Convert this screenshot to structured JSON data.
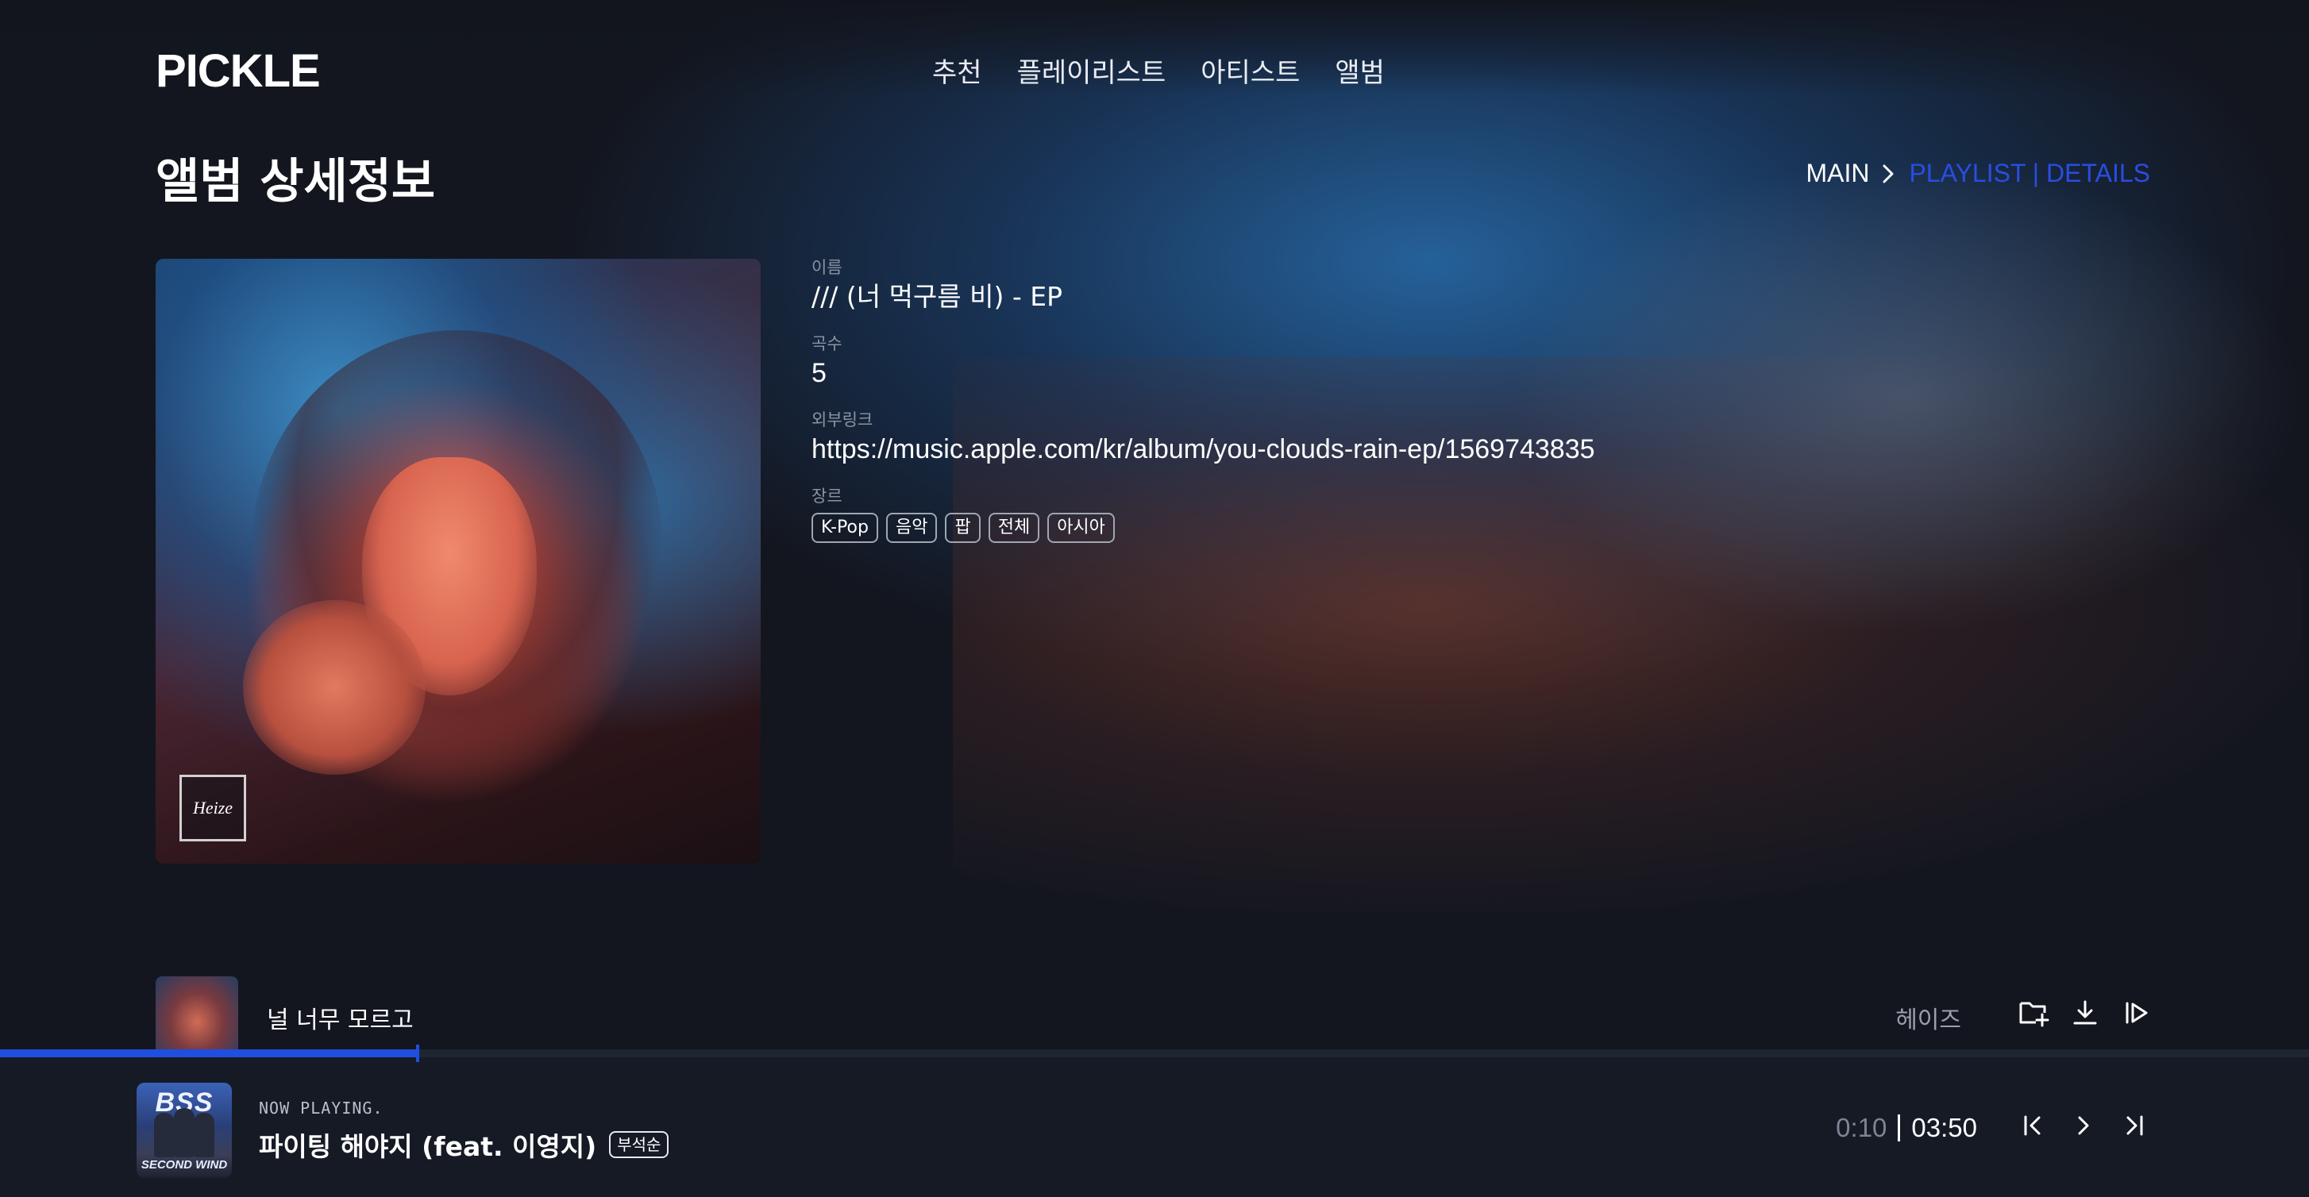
{
  "app": {
    "logo": "PICKLE"
  },
  "nav": {
    "items": [
      {
        "label": "추천"
      },
      {
        "label": "플레이리스트"
      },
      {
        "label": "아티스트"
      },
      {
        "label": "앨범"
      }
    ]
  },
  "page": {
    "title": "앨범 상세정보"
  },
  "breadcrumb": {
    "main": "MAIN",
    "active": "PLAYLIST | DETAILS"
  },
  "album": {
    "cover_mark": "Heize",
    "name_label": "이름",
    "name": "/// (너 먹구름 비) - EP",
    "count_label": "곡수",
    "count": "5",
    "link_label": "외부링크",
    "link": "https://music.apple.com/kr/album/you-clouds-rain-ep/1569743835",
    "genre_label": "장르",
    "genres": [
      "K-Pop",
      "음악",
      "팝",
      "전체",
      "아시아"
    ]
  },
  "track": {
    "title": "널 너무 모르고",
    "artist": "헤이즈",
    "icons": [
      "folder-add-icon",
      "download-icon",
      "play-next-icon"
    ]
  },
  "progress": {
    "fraction": 0.181
  },
  "player": {
    "now_playing_label": "NOW PLAYING.",
    "cover_text": "BSS",
    "cover_subtext": "SECOND WIND",
    "title": "파이팅 해야지 (feat. 이영지)",
    "badge": "부석순",
    "current_time": "0:10",
    "duration": "03:50"
  },
  "colors": {
    "accent": "#1f4fe0",
    "breadcrumb_active": "#2a4de0",
    "background": "#13161f"
  }
}
